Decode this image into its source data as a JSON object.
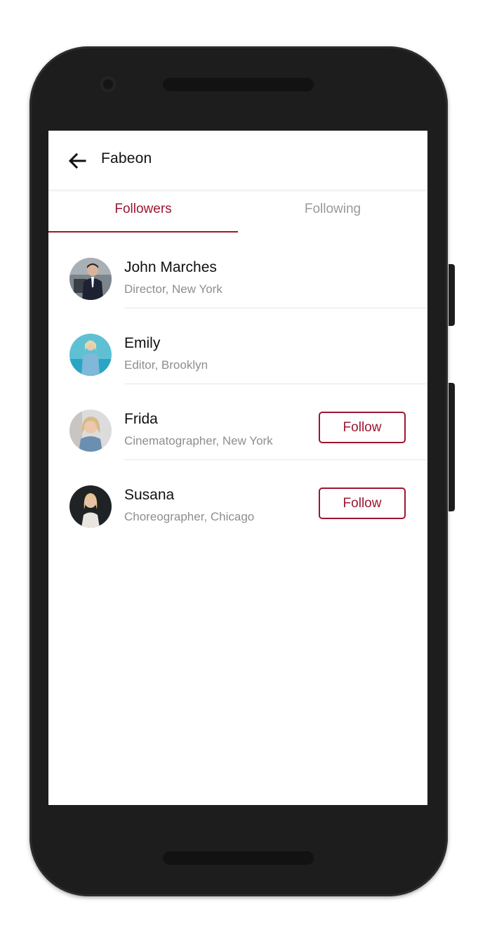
{
  "theme": {
    "accent": "#9c1631",
    "inactive_tab": "#9a9a9a",
    "frame": "#1d1d1d"
  },
  "appbar": {
    "back_icon": "arrow-left-icon",
    "title": "Fabeon"
  },
  "tabs": [
    {
      "label": "Followers",
      "active": true
    },
    {
      "label": "Following",
      "active": false
    }
  ],
  "people": [
    {
      "name": "John Marches",
      "subtitle": "Director, New York",
      "show_follow": false,
      "follow_label": ""
    },
    {
      "name": "Emily",
      "subtitle": "Editor, Brooklyn",
      "show_follow": false,
      "follow_label": ""
    },
    {
      "name": "Frida",
      "subtitle": "Cinematographer, New York",
      "show_follow": true,
      "follow_label": "Follow"
    },
    {
      "name": "Susana",
      "subtitle": "Choreographer, Chicago",
      "show_follow": true,
      "follow_label": "Follow"
    }
  ]
}
